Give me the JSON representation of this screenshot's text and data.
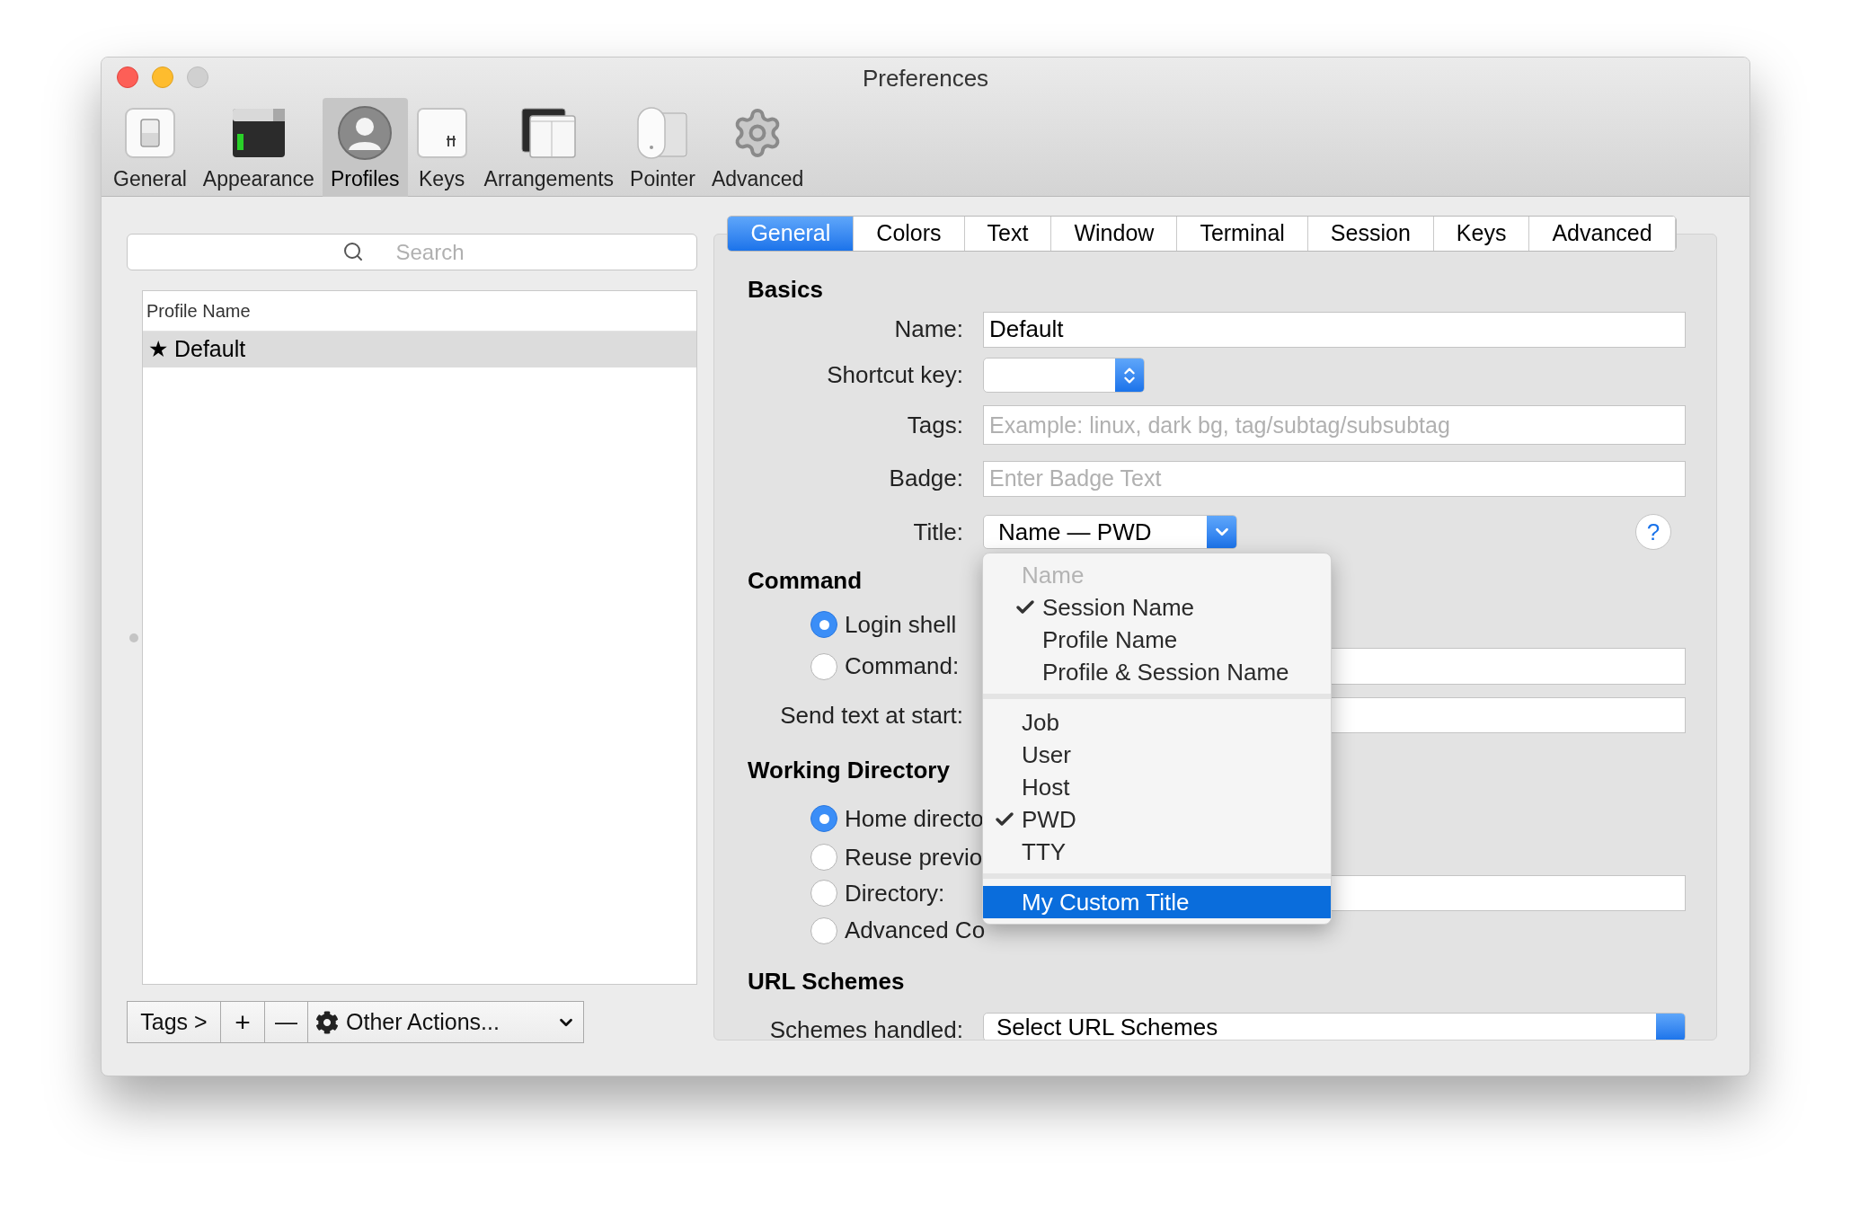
{
  "window": {
    "title": "Preferences"
  },
  "toolbar": {
    "items": [
      {
        "label": "General",
        "kind": "general",
        "selected": false
      },
      {
        "label": "Appearance",
        "kind": "appearance",
        "selected": false
      },
      {
        "label": "Profiles",
        "kind": "profiles",
        "selected": true
      },
      {
        "label": "Keys",
        "kind": "keys",
        "selected": false
      },
      {
        "label": "Arrangements",
        "kind": "arrangements",
        "selected": false
      },
      {
        "label": "Pointer",
        "kind": "pointer",
        "selected": false
      },
      {
        "label": "Advanced",
        "kind": "advanced",
        "selected": false
      }
    ]
  },
  "profiles": {
    "search": {
      "placeholder": "Search"
    },
    "column": "Profile Name",
    "rows": [
      {
        "name": "★ Default",
        "selected": true
      }
    ],
    "bottom_bar": {
      "tags": "Tags >",
      "add": "+",
      "remove": "—",
      "other_actions": "Other Actions..."
    }
  },
  "tabs": [
    {
      "label": "General",
      "selected": true
    },
    {
      "label": "Colors",
      "selected": false
    },
    {
      "label": "Text",
      "selected": false
    },
    {
      "label": "Window",
      "selected": false
    },
    {
      "label": "Terminal",
      "selected": false
    },
    {
      "label": "Session",
      "selected": false
    },
    {
      "label": "Keys",
      "selected": false
    },
    {
      "label": "Advanced",
      "selected": false
    }
  ],
  "basics": {
    "heading": "Basics",
    "name": {
      "label": "Name:",
      "value": "Default"
    },
    "shortcut_key": {
      "label": "Shortcut key:"
    },
    "tags": {
      "label": "Tags:",
      "placeholder": "Example: linux, dark bg, tag/subtag/subsubtag"
    },
    "badge": {
      "label": "Badge:",
      "placeholder": "Enter Badge Text"
    },
    "title": {
      "label": "Title:",
      "value": "Name — PWD",
      "help": "?"
    }
  },
  "command": {
    "heading": "Command",
    "options": [
      {
        "label": "Login shell",
        "selected": true
      },
      {
        "label": "Command:",
        "selected": false
      }
    ],
    "send_text": {
      "label": "Send text at start:"
    }
  },
  "working_directory": {
    "heading": "Working Directory",
    "options": [
      {
        "label": "Home directo",
        "selected": true
      },
      {
        "label": "Reuse previo",
        "selected": false
      },
      {
        "label": "Directory:",
        "selected": false
      },
      {
        "label": "Advanced Co",
        "selected": false
      }
    ]
  },
  "url_schemes": {
    "heading": "URL Schemes",
    "schemes_handled": {
      "label": "Schemes handled:",
      "value": "Select URL Schemes"
    }
  },
  "title_menu": {
    "groups": [
      {
        "items": [
          {
            "label": "Name",
            "disabled": true,
            "checked": false,
            "selected": false,
            "children": [
              {
                "label": "Session Name",
                "disabled": false,
                "checked": true,
                "selected": false
              },
              {
                "label": "Profile Name",
                "disabled": false,
                "checked": false,
                "selected": false
              },
              {
                "label": "Profile & Session Name",
                "disabled": false,
                "checked": false,
                "selected": false
              }
            ]
          }
        ]
      },
      {
        "items": [
          {
            "label": "Job",
            "disabled": false,
            "checked": false,
            "selected": false
          },
          {
            "label": "User",
            "disabled": false,
            "checked": false,
            "selected": false
          },
          {
            "label": "Host",
            "disabled": false,
            "checked": false,
            "selected": false
          },
          {
            "label": "PWD",
            "disabled": false,
            "checked": true,
            "selected": false
          },
          {
            "label": "TTY",
            "disabled": false,
            "checked": false,
            "selected": false
          }
        ]
      },
      {
        "items": [
          {
            "label": "My Custom Title",
            "disabled": false,
            "checked": false,
            "selected": true
          }
        ]
      }
    ]
  }
}
